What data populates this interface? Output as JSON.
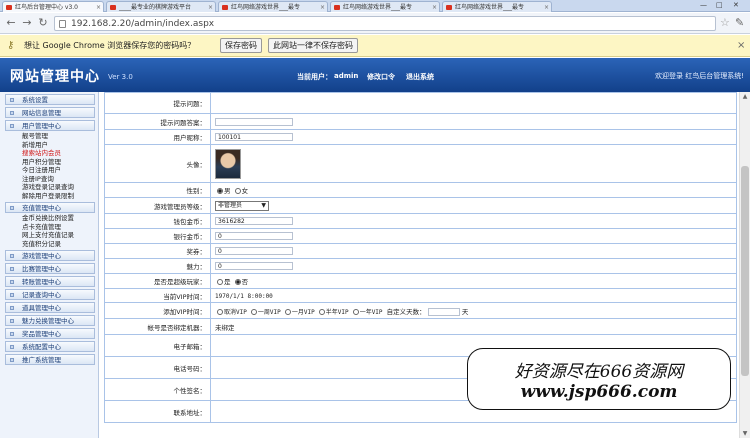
{
  "browser": {
    "tabs": [
      {
        "label": "红鸟后台管理中心 v3.0"
      },
      {
        "label": "____最专业的棋牌游戏平台"
      },
      {
        "label": "红鸟网络游戏世界___最专"
      },
      {
        "label": "红鸟网络游戏世界___最专"
      },
      {
        "label": "红鸟网络游戏世界___最专"
      }
    ],
    "url": "192.168.2.20/admin/index.aspx",
    "window_controls": [
      "—",
      "□",
      "✕"
    ]
  },
  "infobar": {
    "message": "想让 Google Chrome 浏览器保存您的密码吗？",
    "save_label": "保存密码",
    "never_label": "此网站一律不保存密码"
  },
  "header": {
    "title": "网站管理中心",
    "version": "Ver 3.0",
    "current_user_label": "当前用户：",
    "current_user": "admin",
    "change_password": "修改口令",
    "logout": "退出系统",
    "welcome": "欢迎登录 红鸟后台管理系统!"
  },
  "sidebar": {
    "groups": [
      {
        "label": "系统设置",
        "items": []
      },
      {
        "label": "网站信息管理",
        "items": []
      },
      {
        "label": "用户管理中心",
        "items": [
          "靓号管理",
          "新增用户",
          "搜索站内会员",
          "用户积分管理",
          "今日注册用户",
          "注册IP查询",
          "游戏登录记录查询",
          "解除用户登录限制"
        ]
      },
      {
        "label": "充值管理中心",
        "items": [
          "金币兑换比例设置",
          "点卡充值管理",
          "网上支付充值记录",
          "充值积分记录"
        ]
      },
      {
        "label": "游戏管理中心",
        "items": []
      },
      {
        "label": "比赛管理中心",
        "items": []
      },
      {
        "label": "转账管理中心",
        "items": []
      },
      {
        "label": "记录查询中心",
        "items": []
      },
      {
        "label": "道具管理中心",
        "items": []
      },
      {
        "label": "魅力兑换管理中心",
        "items": []
      },
      {
        "label": "奖品管理中心",
        "items": []
      },
      {
        "label": "系统配置中心",
        "items": []
      },
      {
        "label": "推广系统管理",
        "items": []
      }
    ],
    "highlighted_item": "搜索站内会员"
  },
  "form": {
    "question_label": "提示问题：",
    "answer_label": "提示问题答案：",
    "nickname_label": "用户昵称：",
    "nickname_value": "100101",
    "avatar_label": "头像：",
    "gender_label": "性别：",
    "gender_male": "男",
    "gender_female": "女",
    "admin_level_label": "游戏管理员等级：",
    "admin_level_value": "非管理员",
    "wallet_label": "钱包金币：",
    "wallet_value": "3616282",
    "bank_label": "银行金币：",
    "bank_value": "0",
    "lottery_label": "奖券：",
    "lottery_value": "0",
    "charm_label": "魅力：",
    "charm_value": "0",
    "super_player_label": "是否是超级玩家：",
    "super_yes": "是",
    "super_no": "否",
    "vip_time_label": "当前VIP时间：",
    "vip_time_value": "1970/1/1 8:00:00",
    "add_vip_label": "添加VIP时间：",
    "vip_options": [
      "取消VIP",
      "一周VIP",
      "一月VIP",
      "半年VIP",
      "一年VIP"
    ],
    "custom_days_label": "自定义天数：",
    "days_unit": "天",
    "machine_lock_label": "帐号是否绑定机器：",
    "machine_lock_value": "未绑定",
    "email_label": "电子邮箱：",
    "phone_label": "电话号码：",
    "signature_label": "个性签名：",
    "address_label": "联系地址："
  },
  "watermark": {
    "line1": "好资源尽在666资源网",
    "line2": "www.jsp666.com"
  }
}
